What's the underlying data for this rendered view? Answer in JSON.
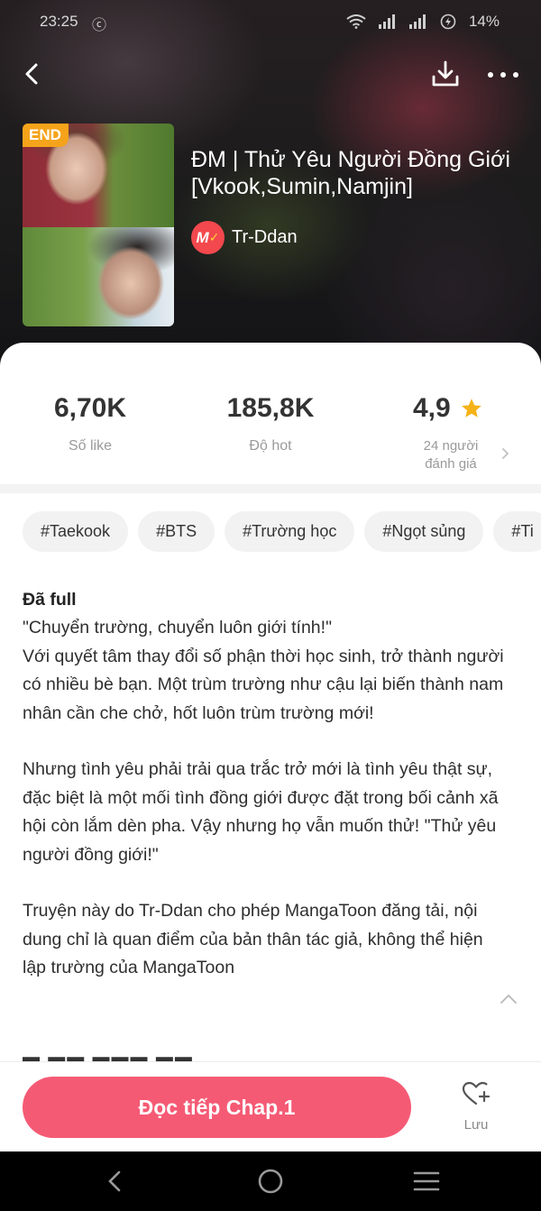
{
  "status_bar": {
    "time": "23:25",
    "app_indicator": "ⓒ",
    "battery": "14%"
  },
  "header": {
    "back_icon": "chevron-left-icon",
    "download_icon": "download-icon",
    "more_icon": "more-horizontal-icon"
  },
  "book": {
    "badge": "END",
    "title": "ĐM | Thử Yêu Người Đồng Giới [Vkook,Sumin,Namjin]",
    "author": "Tr-Ddan",
    "author_logo": "M"
  },
  "stats": {
    "likes": {
      "value": "6,70K",
      "label": "Số like"
    },
    "hot": {
      "value": "185,8K",
      "label": "Độ hot"
    },
    "rating": {
      "value": "4,9",
      "label_line1": "24 người",
      "label_line2": "đánh giá"
    }
  },
  "tags": [
    "#Taekook",
    "#BTS",
    "#Trường học",
    "#Ngọt sủng",
    "#Ti"
  ],
  "description": {
    "heading": "Đã full",
    "line1": "\"Chuyển trường, chuyển luôn giới tính!\"",
    "paragraph1": "Với quyết tâm thay đổi số phận thời học sinh, trở thành người có nhiều bè bạn. Một trùm trường như cậu lại biến thành nam nhân cần che chở, hốt luôn trùm trường mới!",
    "paragraph2": "Nhưng tình yêu phải trải qua trắc trở mới là tình yêu thật sự, đặc biệt là một mối tình đồng giới được đặt trong bối cảnh xã hội còn lắm dèn pha. Vậy nhưng họ vẫn muốn thử! \"Thử yêu người đồng giới!\"",
    "paragraph3": "Truyện này do Tr-Ddan cho phép MangaToon đăng tải, nội dung chỉ là quan điểm của bản thân tác giả, không thể hiện lập trường của MangaToon"
  },
  "actions": {
    "read_label": "Đọc tiếp Chap.1",
    "save_label": "Lưu"
  },
  "colors": {
    "accent": "#f55a74",
    "badge": "#f5a31a",
    "star": "#f6b317"
  }
}
